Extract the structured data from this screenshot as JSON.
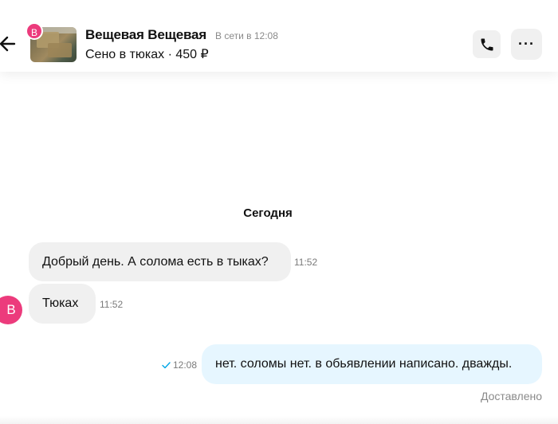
{
  "header": {
    "seller_name": "Вещевая Вещевая",
    "online_status": "В сети в 12:08",
    "item_line": "Сено в тюках · 450 ₽",
    "avatar_letter": "В",
    "call_icon": "phone-icon",
    "more_icon": "more-dots-icon",
    "more_label": "···"
  },
  "chat": {
    "date_separator": "Сегодня",
    "incoming_avatar_letter": "В",
    "messages": [
      {
        "direction": "in",
        "text": "Добрый день. А солома есть в тыках?",
        "time": "11:52"
      },
      {
        "direction": "in",
        "text": "Тюках",
        "time": "11:52"
      },
      {
        "direction": "out",
        "text": "нет. соломы нет. в обьявлении написано. дважды.",
        "time": "12:08",
        "status_icon": "read-check-icon"
      }
    ],
    "delivery_status": "Доставлено"
  },
  "colors": {
    "avatar": "#ec3b7c",
    "incoming_bubble": "#f0f0f0",
    "outgoing_bubble": "#e6f6ff",
    "check": "#00a6e6"
  }
}
